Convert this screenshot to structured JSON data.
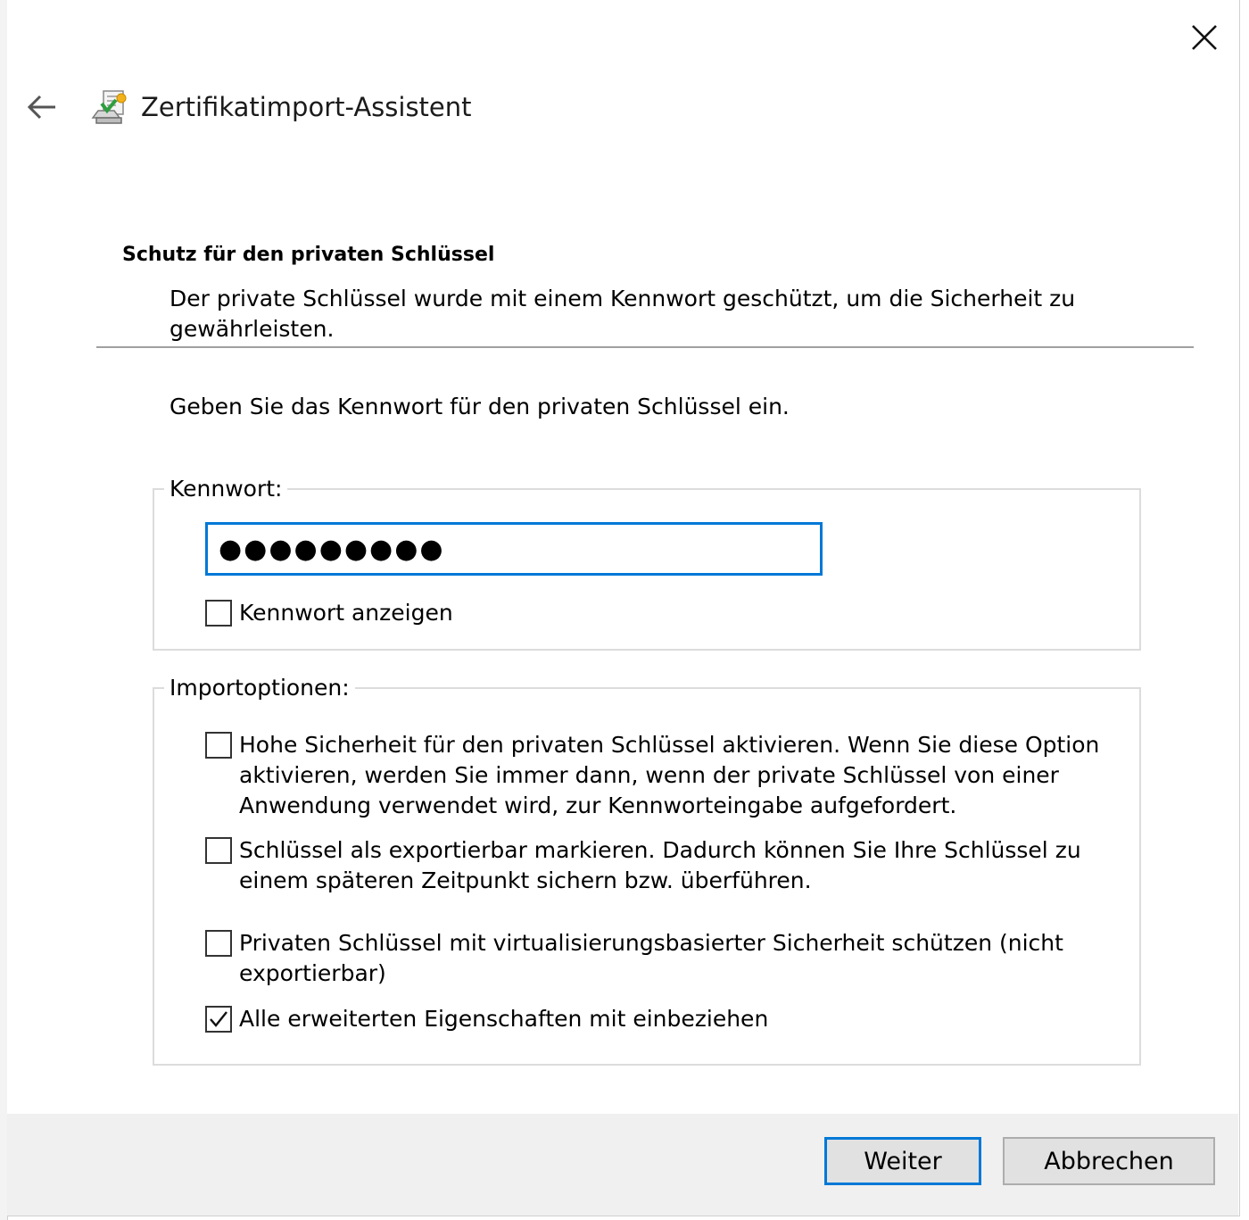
{
  "wizard": {
    "title": "Zertifikatimport-Assistent"
  },
  "section": {
    "title": "Schutz für den privaten Schlüssel",
    "description": "Der private Schlüssel wurde mit einem Kennwort geschützt, um die Sicherheit zu gewährleisten."
  },
  "instruction": "Geben Sie das Kennwort für den privaten Schlüssel ein.",
  "password_group": {
    "legend": "Kennwort:",
    "value_masked": "●●●●●●●●●",
    "show_password_label": "Kennwort anzeigen",
    "show_password_checked": false
  },
  "import_options": {
    "legend": "Importoptionen:",
    "items": [
      {
        "label": "Hohe Sicherheit für den privaten Schlüssel aktivieren. Wenn Sie diese Option aktivieren, werden Sie immer dann, wenn der private Schlüssel von einer Anwendung verwendet wird, zur Kennworteingabe aufgefordert.",
        "checked": false
      },
      {
        "label": "Schlüssel als exportierbar markieren. Dadurch können Sie Ihre Schlüssel zu einem späteren Zeitpunkt sichern bzw. überführen.",
        "checked": false
      },
      {
        "label": "Privaten Schlüssel mit virtualisierungsbasierter Sicherheit schützen (nicht exportierbar)",
        "checked": false
      },
      {
        "label": "Alle erweiterten Eigenschaften mit einbeziehen",
        "checked": true
      }
    ]
  },
  "buttons": {
    "next": "Weiter",
    "cancel": "Abbrechen"
  },
  "icons": {
    "close": "close-icon",
    "back": "back-arrow-icon",
    "wizard": "certificate-import-icon"
  },
  "colors": {
    "accent": "#0078d7",
    "footer": "#f0f0f0"
  }
}
